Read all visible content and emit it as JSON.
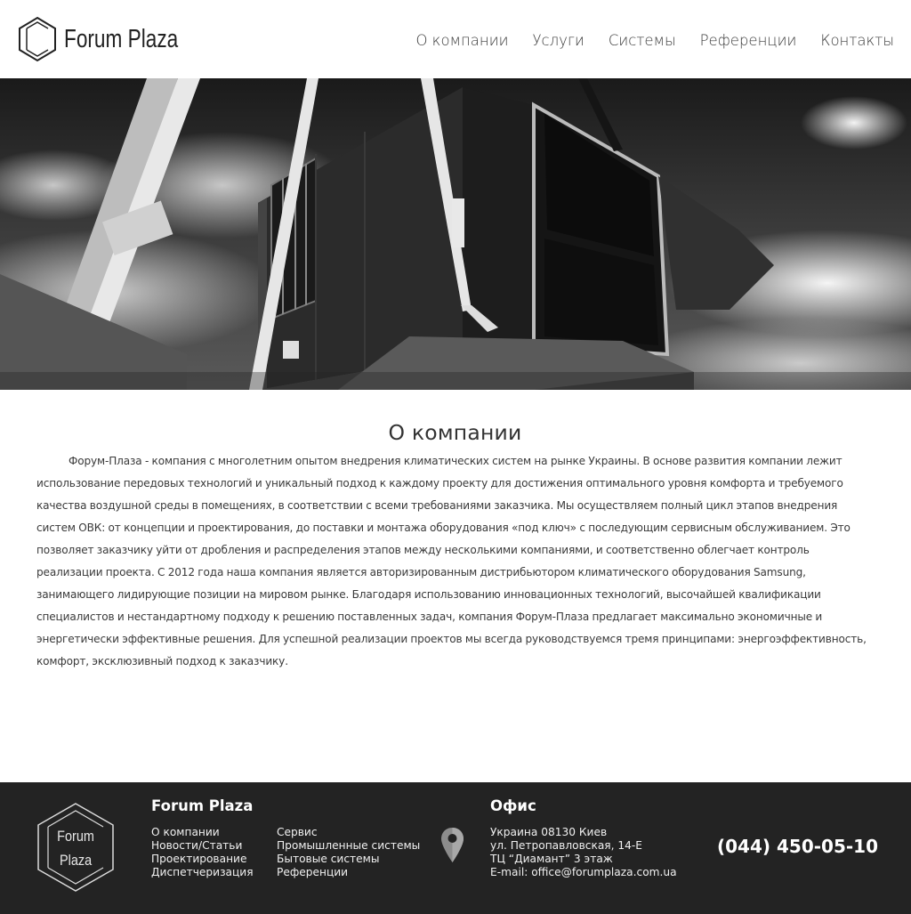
{
  "header": {
    "brand": "Forum  Plaza",
    "nav": [
      {
        "label": "О компании"
      },
      {
        "label": "Услуги"
      },
      {
        "label": "Системы"
      },
      {
        "label": "Референции"
      },
      {
        "label": "Контакты"
      }
    ]
  },
  "hero": {
    "icon": "hvac-unit-lifted-by-crane-photo"
  },
  "main": {
    "title": "О компании",
    "text": "Форум-Плаза - компания с многолетним опытом внедрения климатических систем на рынке Украины.  В основе развития компании лежит использование передовых технологий  и уникальный подход к каждому проекту  для достижения оптимального  уровня комфорта и требуемого качества воздушной среды в помещениях, в соответствии с всеми требованиями заказчика. Мы осуществляем полный цикл этапов внедрения систем ОВК:  от концепции и проектирования, до поставки и монтажа оборудования «под ключ» с последующим сервисным  обслуживанием. Это позволяет заказчику уйти от дробления и распределения этапов между несколькими компаниями, и соответственно облегчает контроль реализации проекта. С  2012 года наша компания является авторизированным дистрибьютором климатического оборудования Samsung, занимающего лидирующие позиции на мировом рынке. Благодаря использованию инновационных технологий, высочайшей квалификации специалистов и нестандартному подходу к решению поставленных задач, компания Форум-Плаза предлагает максимально экономичные и энергетически эффективные решения. Для успешной  реализации проектов мы всегда руководствуемся тремя принципами: энергоэффективность, комфорт, эксклюзивный подход к заказчику."
  },
  "footer": {
    "logo_lines": [
      "Forum",
      "Plaza"
    ],
    "brand": "Forum Plaza",
    "col1": [
      {
        "label": "О компании"
      },
      {
        "label": "Новости/Статьи"
      },
      {
        "label": "Проектирование"
      },
      {
        "label": "Диспетчеризация"
      }
    ],
    "col2": [
      {
        "label": "Сервис"
      },
      {
        "label": "Промышленные системы"
      },
      {
        "label": "Бытовые системы"
      },
      {
        "label": "Референции"
      }
    ],
    "office_title": "Офис",
    "office_lines": [
      "Украина 08130 Киев",
      "ул. Петропавловская, 14-Е",
      "ТЦ “Диамант” 3 этаж",
      "E-mail: office@forumplaza.com.ua"
    ],
    "phone": "(044) 450-05-10"
  },
  "colors": {
    "footer_bg": "#232323",
    "text": "#3a3a3a",
    "header_bg": "#ffffff"
  }
}
